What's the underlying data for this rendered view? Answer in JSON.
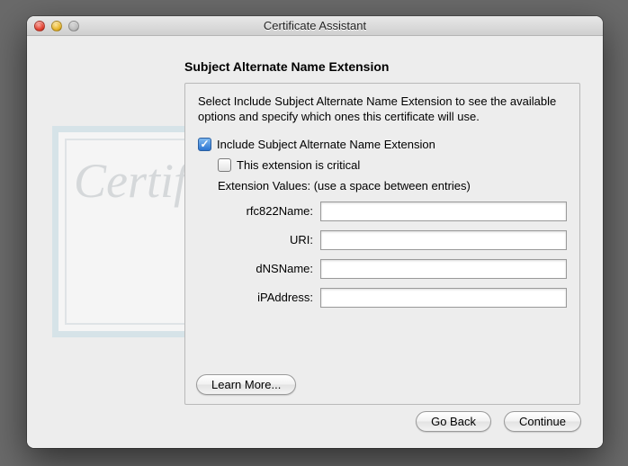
{
  "window": {
    "title": "Certificate Assistant"
  },
  "heading": "Subject Alternate Name Extension",
  "intro": "Select Include Subject Alternate Name Extension to see the available options and specify which ones this certificate will use.",
  "checkboxes": {
    "include_label": "Include Subject Alternate Name Extension",
    "critical_label": "This extension is critical"
  },
  "extension_values_label": "Extension Values: (use a space between entries)",
  "fields": {
    "rfc822": {
      "label": "rfc822Name:",
      "value": ""
    },
    "uri": {
      "label": "URI:",
      "value": ""
    },
    "dns": {
      "label": "dNSName:",
      "value": ""
    },
    "ip": {
      "label": "iPAddress:",
      "value": ""
    }
  },
  "buttons": {
    "learn_more": "Learn More...",
    "go_back": "Go Back",
    "continue": "Continue"
  },
  "bg": {
    "script_text": "Certific"
  }
}
